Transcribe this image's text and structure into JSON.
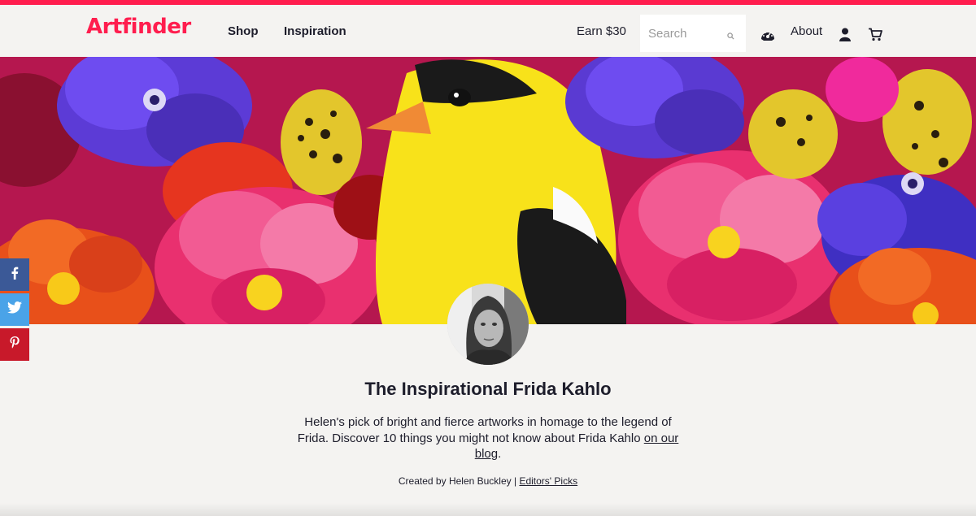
{
  "brand": {
    "name": "Artfinder",
    "color": "#ff1d4e"
  },
  "nav": {
    "shop": "Shop",
    "inspiration": "Inspiration",
    "earn": "Earn $30",
    "search_placeholder": "Search",
    "about": "About"
  },
  "icons": {
    "search": "search-icon",
    "dashboard": "dashboard-icon",
    "user": "user-icon",
    "cart": "cart-icon",
    "facebook": "facebook-icon",
    "twitter": "twitter-icon",
    "pinterest": "pinterest-icon"
  },
  "hero": {
    "image": "painting of yellow bird among flowers"
  },
  "collection": {
    "title": "The Inspirational Frida Kahlo",
    "description_before_link": "Helen's pick of bright and fierce artworks in homage to the legend of Frida. Discover 10 things you might not know about Frida Kahlo ",
    "description_link": "on our blog",
    "description_after_link": ".",
    "created_by_prefix": "Created by ",
    "creator_name": "Helen Buckley",
    "separator": " | ",
    "category_link": "Editors' Picks"
  },
  "colors": {
    "facebook": "#3b5997",
    "twitter": "#4aa3e8",
    "pinterest": "#c8192a"
  }
}
